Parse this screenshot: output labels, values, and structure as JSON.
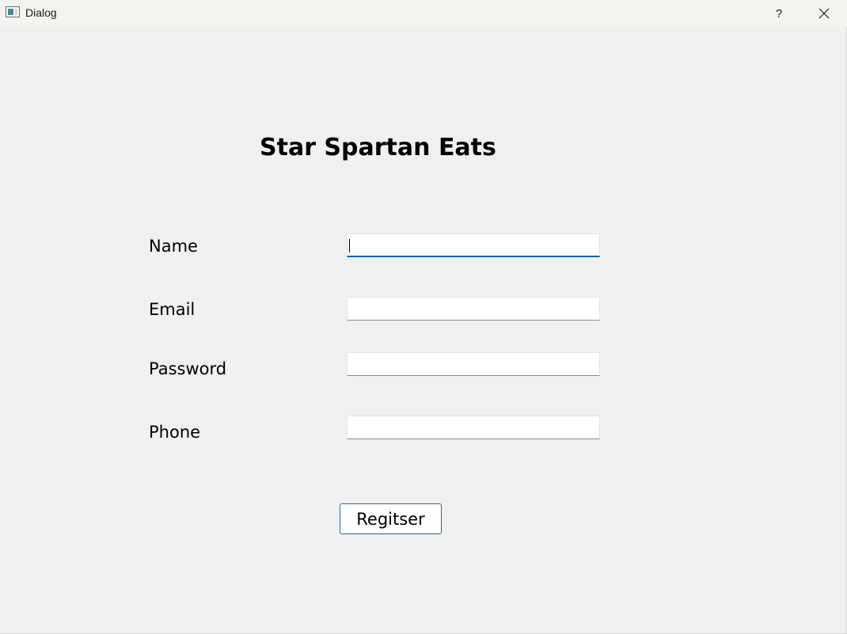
{
  "window": {
    "title": "Dialog",
    "help_label": "?",
    "close_icon": "close-icon",
    "app_icon": "window-icon"
  },
  "form": {
    "heading": "Star Spartan Eats",
    "fields": [
      {
        "label": "Name",
        "value": "",
        "placeholder": "",
        "focused": true
      },
      {
        "label": "Email",
        "value": "",
        "placeholder": ""
      },
      {
        "label": "Password",
        "value": "",
        "placeholder": ""
      },
      {
        "label": "Phone",
        "value": "",
        "placeholder": ""
      }
    ],
    "submit_label": "Regitser"
  },
  "colors": {
    "background": "#f0f0f0",
    "titlebar": "#f4f3ef",
    "focus_accent": "#0a64ad",
    "button_border": "#1f6f99"
  }
}
